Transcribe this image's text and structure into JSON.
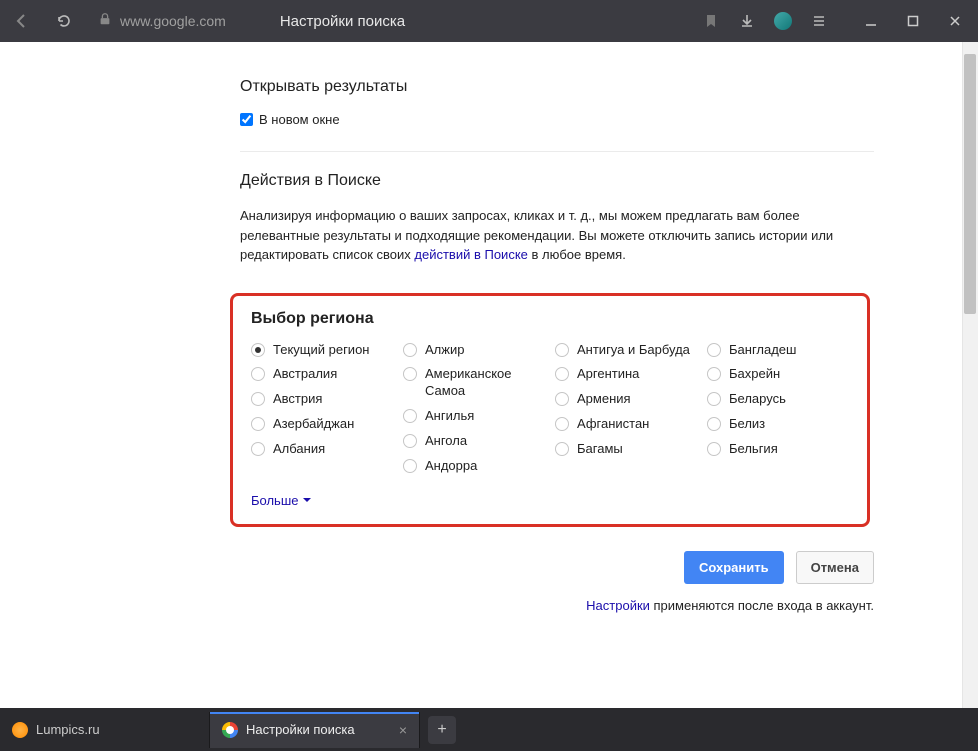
{
  "titlebar": {
    "url": "www.google.com",
    "page_title": "Настройки поиска"
  },
  "sections": {
    "open_results": {
      "title": "Открывать результаты",
      "checkbox_label": "В новом окне"
    },
    "search_actions": {
      "title": "Действия в Поиске",
      "desc_1": "Анализируя информацию о ваших запросах, кликах и т. д., мы можем предлагать вам более релевантные результаты и подходящие рекомендации. Вы можете отключить запись истории или редактировать список своих ",
      "link": "действий в Поиске",
      "desc_2": " в любое время."
    },
    "region": {
      "title": "Выбор региона",
      "cols": [
        [
          "Текущий регион",
          "Австралия",
          "Австрия",
          "Азербайджан",
          "Албания"
        ],
        [
          "Алжир",
          "Американское Самоа",
          "Ангилья",
          "Ангола",
          "Андорра"
        ],
        [
          "Антигуа и Барбуда",
          "Аргентина",
          "Армения",
          "Афганистан",
          "Багамы"
        ],
        [
          "Бангладеш",
          "Бахрейн",
          "Беларусь",
          "Белиз",
          "Бельгия"
        ]
      ],
      "more": "Больше"
    }
  },
  "buttons": {
    "save": "Сохранить",
    "cancel": "Отмена"
  },
  "login_note": {
    "link": "Настройки",
    "text": " применяются после входа в аккаунт."
  },
  "tabs": {
    "t1": "Lumpics.ru",
    "t2": "Настройки поиска"
  }
}
